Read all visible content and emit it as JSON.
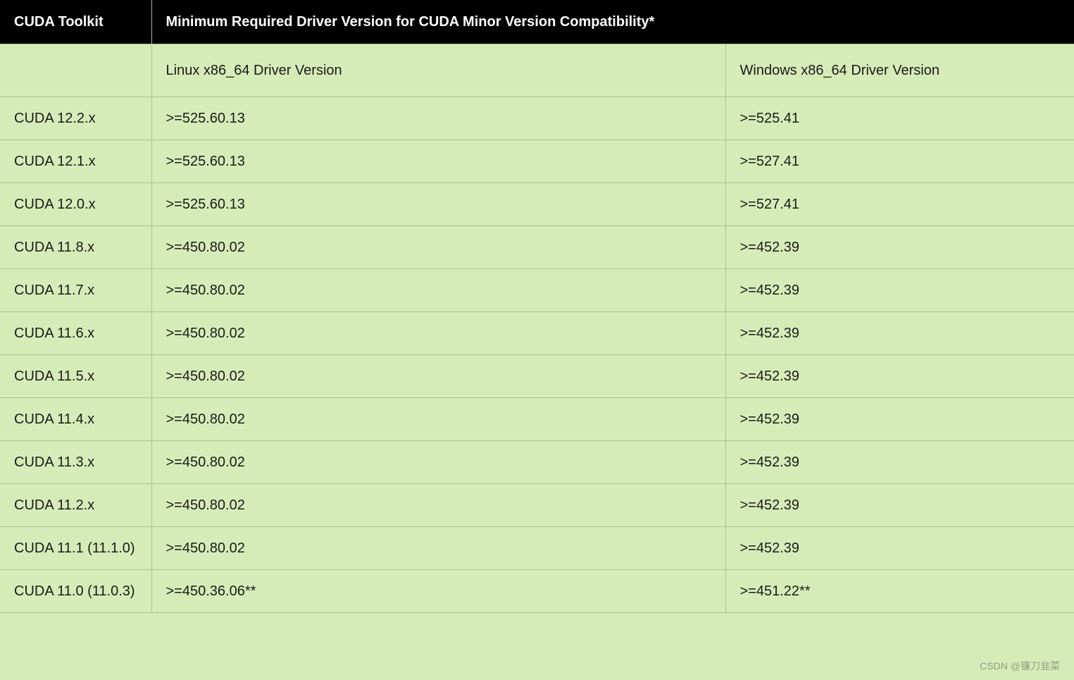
{
  "headers": {
    "col1": "CUDA Toolkit",
    "col2": "Minimum Required Driver Version for CUDA Minor Version Compatibility*"
  },
  "subheaders": {
    "col1": "",
    "col2": "Linux x86_64 Driver Version",
    "col3": "Windows x86_64 Driver Version"
  },
  "rows": [
    {
      "toolkit": "CUDA 12.2.x",
      "linux": ">=525.60.13",
      "windows": ">=525.41"
    },
    {
      "toolkit": "CUDA 12.1.x",
      "linux": ">=525.60.13",
      "windows": ">=527.41"
    },
    {
      "toolkit": "CUDA 12.0.x",
      "linux": ">=525.60.13",
      "windows": ">=527.41"
    },
    {
      "toolkit": "CUDA 11.8.x",
      "linux": ">=450.80.02",
      "windows": ">=452.39"
    },
    {
      "toolkit": "CUDA 11.7.x",
      "linux": ">=450.80.02",
      "windows": ">=452.39"
    },
    {
      "toolkit": "CUDA 11.6.x",
      "linux": ">=450.80.02",
      "windows": ">=452.39"
    },
    {
      "toolkit": "CUDA 11.5.x",
      "linux": ">=450.80.02",
      "windows": ">=452.39"
    },
    {
      "toolkit": "CUDA 11.4.x",
      "linux": ">=450.80.02",
      "windows": ">=452.39"
    },
    {
      "toolkit": "CUDA 11.3.x",
      "linux": ">=450.80.02",
      "windows": ">=452.39"
    },
    {
      "toolkit": "CUDA 11.2.x",
      "linux": ">=450.80.02",
      "windows": ">=452.39"
    },
    {
      "toolkit": "CUDA 11.1 (11.1.0)",
      "linux": ">=450.80.02",
      "windows": ">=452.39"
    },
    {
      "toolkit": "CUDA 11.0 (11.0.3)",
      "linux": ">=450.36.06**",
      "windows": ">=451.22**"
    }
  ],
  "watermark": "CSDN @镰刀韭菜"
}
